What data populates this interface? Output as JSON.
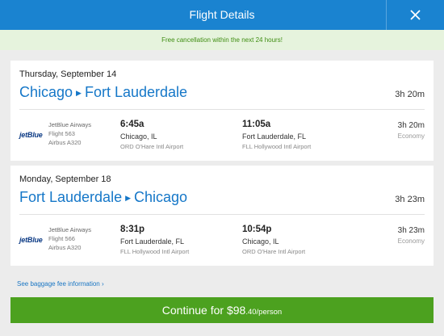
{
  "header": {
    "title": "Flight Details",
    "close_icon": "close-icon"
  },
  "notice": "Free cancellation within the next 24 hours!",
  "flights": [
    {
      "date": "Thursday, September 14",
      "from": "Chicago",
      "to": "Fort Lauderdale",
      "duration": "3h 20m",
      "segment": {
        "logo": "jetBlue",
        "airline": "JetBlue Airways",
        "flight": "Flight 563",
        "aircraft": "Airbus A320",
        "dep_time": "6:45a",
        "dep_city": "Chicago, IL",
        "dep_airport": "ORD O'Hare Intl Airport",
        "arr_time": "11:05a",
        "arr_city": "Fort Lauderdale, FL",
        "arr_airport": "FLL Hollywood Intl Airport",
        "duration": "3h 20m",
        "cabin": "Economy"
      }
    },
    {
      "date": "Monday, September 18",
      "from": "Fort Lauderdale",
      "to": "Chicago",
      "duration": "3h 23m",
      "segment": {
        "logo": "jetBlue",
        "airline": "JetBlue Airways",
        "flight": "Flight 566",
        "aircraft": "Airbus A320",
        "dep_time": "8:31p",
        "dep_city": "Fort Lauderdale, FL",
        "dep_airport": "FLL Hollywood Intl Airport",
        "arr_time": "10:54p",
        "arr_city": "Chicago, IL",
        "arr_airport": "ORD O'Hare Intl Airport",
        "duration": "3h 23m",
        "cabin": "Economy"
      }
    }
  ],
  "baggage_link": "See baggage fee information",
  "cta": {
    "label": "Continue for ",
    "price_main": "$98",
    "price_cents": ".40/person"
  },
  "colors": {
    "header": "#1a83d0",
    "route": "#1577c8",
    "cta": "#4ca11f",
    "notice_bg": "#e6f3dd",
    "notice_text": "#3f8d12"
  }
}
